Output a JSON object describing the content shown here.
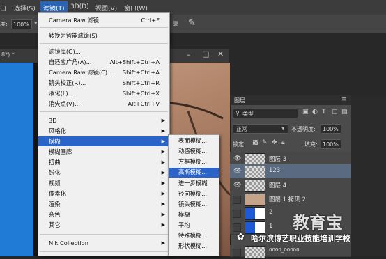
{
  "menubar": {
    "items": [
      "选择(S)",
      "滤镜(T)",
      "3D(D)",
      "视图(V)",
      "窗口(W)"
    ],
    "partial_left": "山",
    "partial_right": "录"
  },
  "options": {
    "label": "度:",
    "zoom": "100%"
  },
  "document": {
    "tab_suffix": "8*) *"
  },
  "filter_menu": {
    "items": [
      {
        "label": "Camera Raw 滤镜",
        "shortcut": "Ctrl+F"
      },
      {
        "label": "转换为智能滤镜(S)",
        "shortcut": ""
      },
      {
        "label": "滤镜库(G)...",
        "shortcut": ""
      },
      {
        "label": "自适应广角(A)...",
        "shortcut": "Alt+Shift+Ctrl+A"
      },
      {
        "label": "Camera Raw 滤镜(C)...",
        "shortcut": "Shift+Ctrl+A"
      },
      {
        "label": "镜头校正(R)...",
        "shortcut": "Shift+Ctrl+R"
      },
      {
        "label": "液化(L)...",
        "shortcut": "Shift+Ctrl+X"
      },
      {
        "label": "消失点(V)...",
        "shortcut": "Alt+Ctrl+V"
      },
      {
        "label": "3D",
        "shortcut": ""
      },
      {
        "label": "风格化",
        "shortcut": ""
      },
      {
        "label": "模糊",
        "shortcut": ""
      },
      {
        "label": "模糊画廊",
        "shortcut": ""
      },
      {
        "label": "扭曲",
        "shortcut": ""
      },
      {
        "label": "锐化",
        "shortcut": ""
      },
      {
        "label": "视频",
        "shortcut": ""
      },
      {
        "label": "像素化",
        "shortcut": ""
      },
      {
        "label": "渲染",
        "shortcut": ""
      },
      {
        "label": "杂色",
        "shortcut": ""
      },
      {
        "label": "其它",
        "shortcut": ""
      },
      {
        "label": "Nik Collection",
        "shortcut": ""
      }
    ]
  },
  "blur_submenu": {
    "items": [
      "表面模糊...",
      "动感模糊...",
      "方框模糊...",
      "高斯模糊...",
      "进一步模糊",
      "径向模糊...",
      "镜头模糊...",
      "模糊",
      "平均",
      "特殊模糊...",
      "形状模糊..."
    ]
  },
  "layers_panel": {
    "title": "图层",
    "filter_kind": "类型",
    "blend_mode": "正常",
    "opacity_label": "不透明度:",
    "opacity": "100%",
    "lock_label": "锁定:",
    "fill_label": "填充:",
    "fill": "100%",
    "layers": [
      {
        "name": "图层 3",
        "visible": true
      },
      {
        "name": "123",
        "visible": true
      },
      {
        "name": "图层 4",
        "visible": true
      },
      {
        "name": "图层 1 拷贝 2",
        "visible": false
      },
      {
        "name": "2",
        "visible": false
      },
      {
        "name": "1",
        "visible": false
      },
      {
        "name": "0000_00000",
        "visible": false
      }
    ]
  },
  "watermark": {
    "brand": "教育宝",
    "school": "哈尔滨博艺职业技能培训学校"
  },
  "colors": {
    "menu_highlight": "#2a64c8",
    "blue_layer": "#1f7bd6"
  }
}
